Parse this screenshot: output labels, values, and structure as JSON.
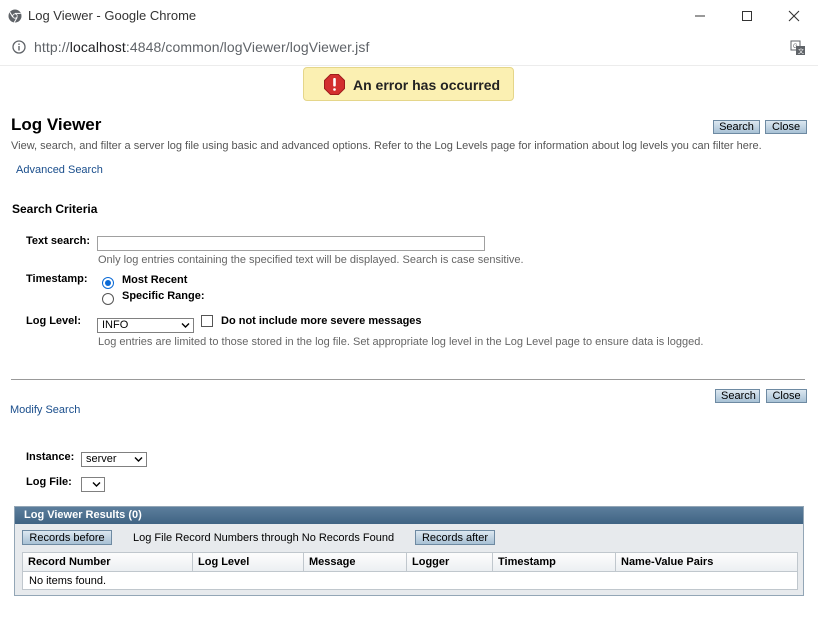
{
  "window": {
    "title": "Log Viewer - Google Chrome",
    "url_prefix": "http://",
    "url_host": "localhost",
    "url_rest": ":4848/common/logViewer/logViewer.jsf"
  },
  "error": {
    "message": "An error has occurred"
  },
  "page": {
    "title": "Log Viewer",
    "help": "View, search, and filter a server log file using basic and advanced options. Refer to the Log Levels page for information about log levels you can filter here.",
    "advanced_link": "Advanced Search",
    "search_btn": "Search",
    "close_btn": "Close"
  },
  "criteria": {
    "title": "Search Criteria",
    "text_search_label": "Text search:",
    "text_search_value": "",
    "text_search_hint": "Only log entries containing the specified text will be displayed. Search is case sensitive.",
    "timestamp_label": "Timestamp:",
    "most_recent": "Most Recent",
    "specific_range": "Specific Range:",
    "selected_timestamp": "Most Recent",
    "log_level_label": "Log Level:",
    "log_level_value": "INFO",
    "exclude_severe": "Do not include more severe messages",
    "exclude_severe_checked": false,
    "log_level_hint": "Log entries are limited to those stored in the log file. Set appropriate log level in the Log Level page to ensure data is logged."
  },
  "lower": {
    "modify_link": "Modify Search",
    "search_btn": "Search",
    "close_btn": "Close",
    "instance_label": "Instance:",
    "instance_value": "server",
    "logfile_label": "Log File:",
    "logfile_value": ""
  },
  "results": {
    "header": "Log Viewer Results (0)",
    "records_before": "Records before",
    "nav_text": "Log File Record Numbers through No Records Found",
    "records_after": "Records after",
    "columns": [
      "Record Number",
      "Log Level",
      "Message",
      "Logger",
      "Timestamp",
      "Name-Value Pairs"
    ],
    "empty_text": "No items found."
  },
  "colors": {
    "link": "#1a4e8c",
    "header_bar": "#4a6d8c",
    "banner": "#fbf0b2",
    "error_icon": "#d32f2f",
    "radio_accent": "#0b6ad6"
  },
  "icons": [
    "chrome-icon",
    "minimize-icon",
    "maximize-icon",
    "close-icon",
    "info-icon",
    "translate-icon",
    "error-icon",
    "chevron-down-icon"
  ]
}
